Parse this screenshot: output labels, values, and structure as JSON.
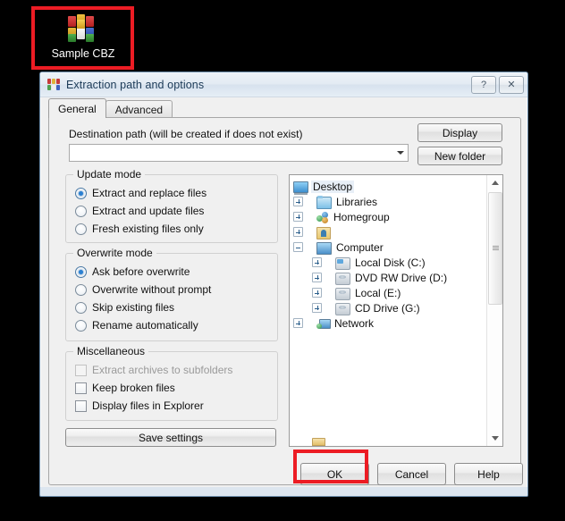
{
  "desktop": {
    "icon": {
      "label": "Sample CBZ",
      "icon": "winrar-archive-icon"
    }
  },
  "annotations": {
    "color": "#ec1c24",
    "targets": [
      "desktop-icon",
      "ok-button"
    ]
  },
  "dialog": {
    "title": "Extraction path and options",
    "title_icon": "winrar-icon",
    "caption_buttons": [
      {
        "name": "help",
        "glyph": "?"
      },
      {
        "name": "close",
        "glyph": "✕"
      }
    ],
    "tabs": [
      {
        "label": "General",
        "active": true
      },
      {
        "label": "Advanced",
        "active": false
      }
    ],
    "destination": {
      "label": "Destination path (will be created if does not exist)",
      "value": "",
      "placeholder": ""
    },
    "side_buttons": [
      {
        "label": "Display"
      },
      {
        "label": "New folder"
      }
    ],
    "update_mode": {
      "title": "Update mode",
      "options": [
        {
          "label": "Extract and replace files",
          "selected": true
        },
        {
          "label": "Extract and update files",
          "selected": false
        },
        {
          "label": "Fresh existing files only",
          "selected": false
        }
      ]
    },
    "overwrite_mode": {
      "title": "Overwrite mode",
      "options": [
        {
          "label": "Ask before overwrite",
          "selected": true
        },
        {
          "label": "Overwrite without prompt",
          "selected": false
        },
        {
          "label": "Skip existing files",
          "selected": false
        },
        {
          "label": "Rename automatically",
          "selected": false
        }
      ]
    },
    "miscellaneous": {
      "title": "Miscellaneous",
      "options": [
        {
          "label": "Extract archives to subfolders",
          "checked": false,
          "disabled": true
        },
        {
          "label": "Keep broken files",
          "checked": false,
          "disabled": false
        },
        {
          "label": "Display files in Explorer",
          "checked": false,
          "disabled": false
        }
      ]
    },
    "save_settings_label": "Save settings",
    "tree": {
      "nodes": [
        {
          "label": "Desktop",
          "indent": 0,
          "expander": "none",
          "icon": "monitor-icon",
          "selected": true
        },
        {
          "label": "Libraries",
          "indent": 1,
          "expander": "plus",
          "icon": "library-folder-icon",
          "selected": false
        },
        {
          "label": "Homegroup",
          "indent": 1,
          "expander": "plus",
          "icon": "homegroup-icon",
          "selected": false
        },
        {
          "label": "",
          "indent": 1,
          "expander": "plus",
          "icon": "user-folder-icon",
          "selected": false
        },
        {
          "label": "Computer",
          "indent": 1,
          "expander": "minus",
          "icon": "computer-icon",
          "selected": false
        },
        {
          "label": "Local Disk (C:)",
          "indent": 2,
          "expander": "plus",
          "icon": "hard-disk-icon",
          "selected": false
        },
        {
          "label": "DVD RW Drive (D:)",
          "indent": 2,
          "expander": "plus",
          "icon": "optical-drive-icon",
          "selected": false
        },
        {
          "label": "Local (E:)",
          "indent": 2,
          "expander": "plus",
          "icon": "drive-icon",
          "selected": false
        },
        {
          "label": "CD Drive (G:)",
          "indent": 2,
          "expander": "plus",
          "icon": "optical-drive-icon",
          "selected": false
        },
        {
          "label": "Network",
          "indent": 1,
          "expander": "plus",
          "icon": "network-icon",
          "selected": false
        }
      ],
      "scrollbar": {
        "up_glyph": "▲",
        "down_glyph": "▼",
        "thumb_position_pct": 6,
        "thumb_size_pct": 42
      }
    },
    "footer_buttons": [
      {
        "label": "OK",
        "name": "ok"
      },
      {
        "label": "Cancel",
        "name": "cancel"
      },
      {
        "label": "Help",
        "name": "help"
      }
    ]
  }
}
